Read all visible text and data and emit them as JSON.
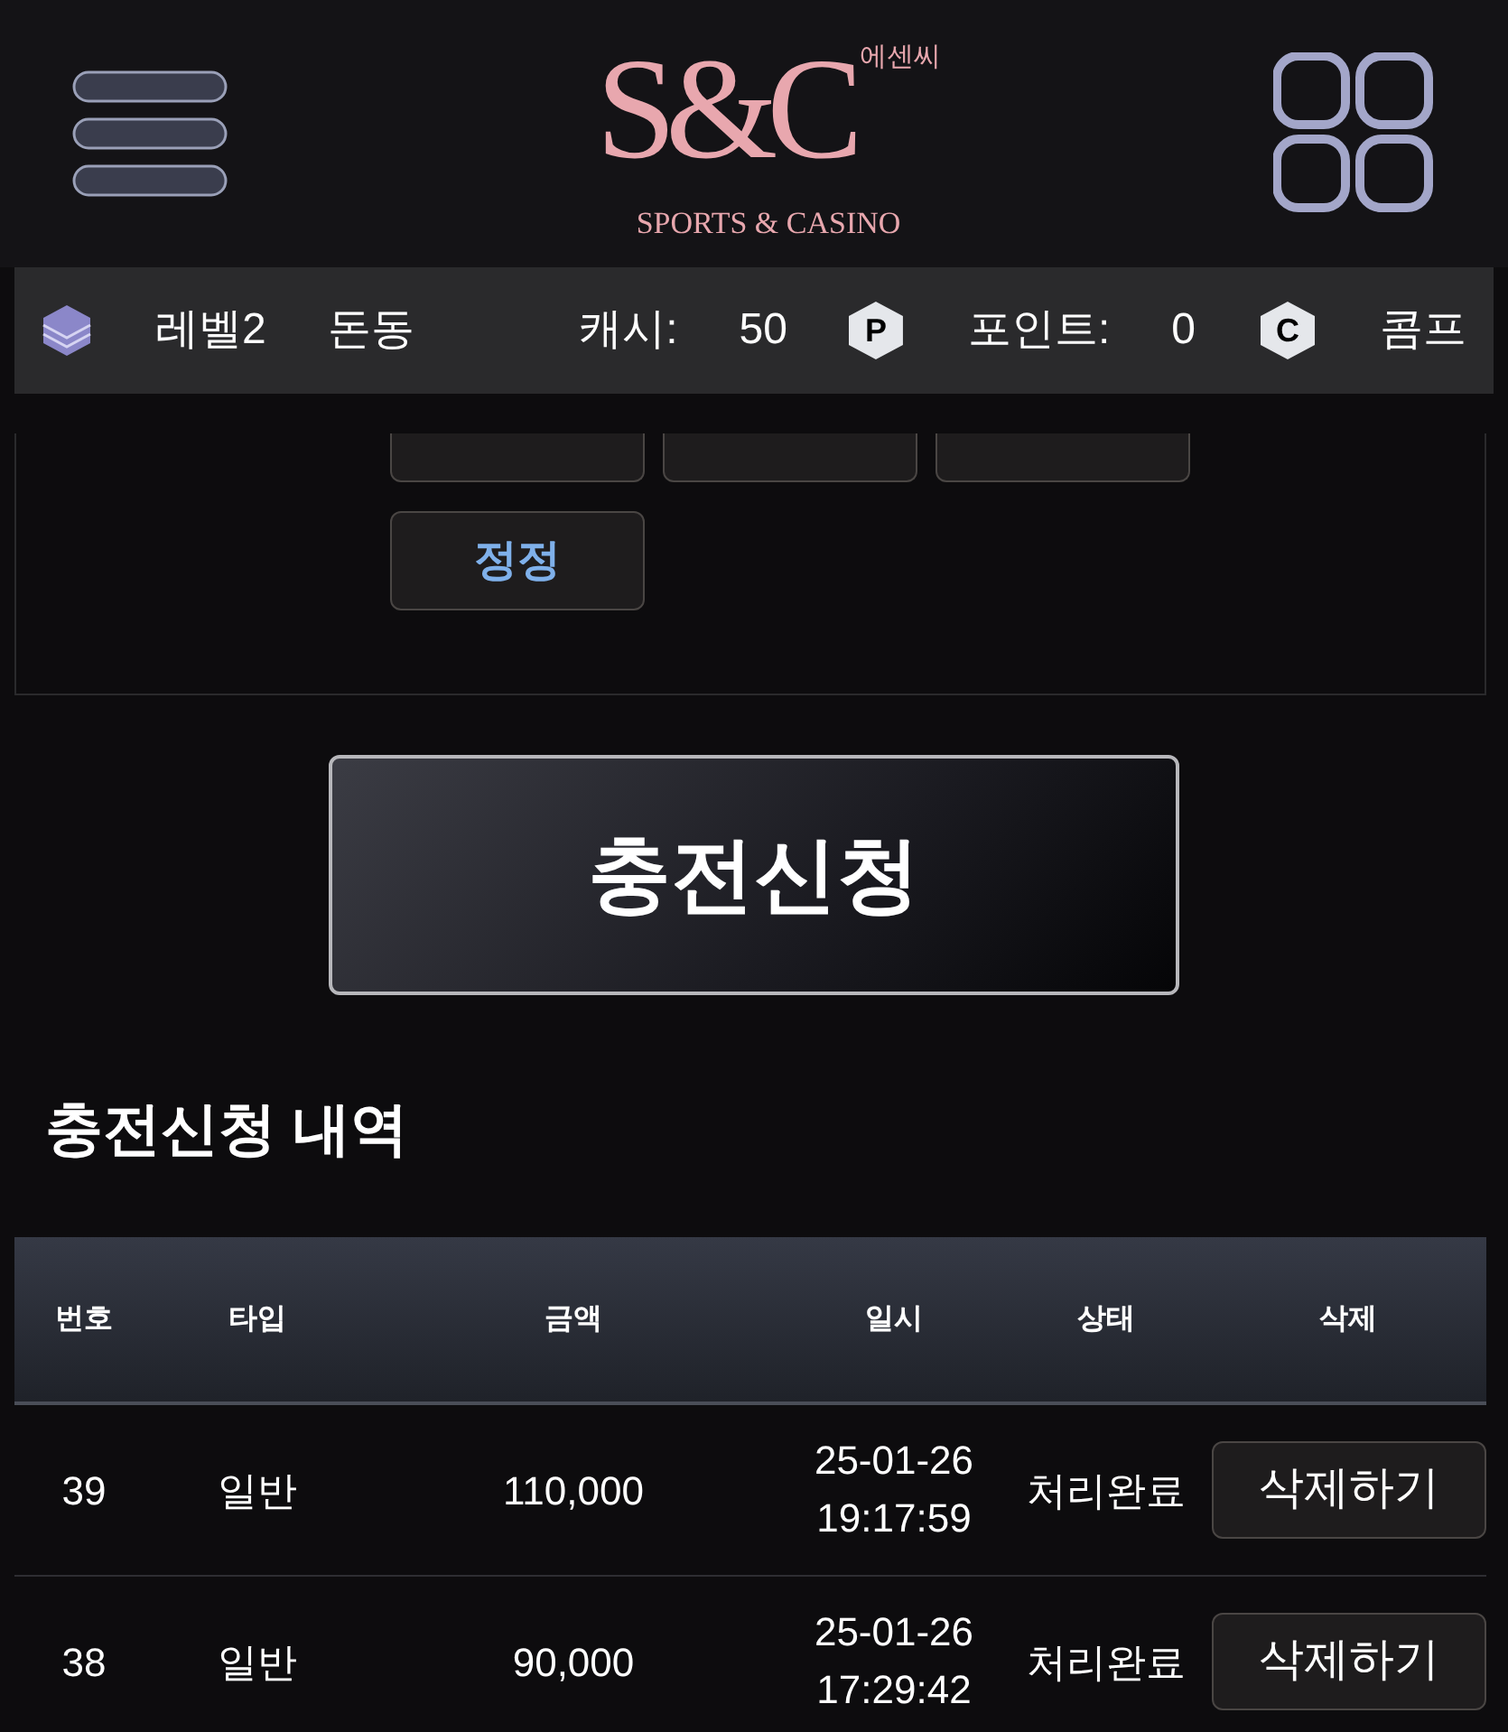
{
  "logo": {
    "monogram": "S&C",
    "korean": "에센씨",
    "tagline": "SPORTS & CASINO"
  },
  "status_bar": {
    "level": "레벨2",
    "nickname": "돈동",
    "cash_label": "캐시:",
    "cash": "50",
    "point_badge": "P",
    "point_label": "포인트:",
    "point": "0",
    "comp_badge": "C",
    "comp_label": "콤프"
  },
  "amount_buttons": [
    {
      "kind": "covered"
    },
    {
      "kind": "covered"
    },
    {
      "kind": "covered"
    },
    {
      "kind": "reset",
      "label": "정정"
    }
  ],
  "submit_button": "충전신청",
  "history": {
    "title": "충전신청 내역",
    "columns": [
      "번호",
      "타입",
      "금액",
      "일시",
      "상태",
      "삭제"
    ],
    "rows": [
      {
        "no": "39",
        "type": "일반",
        "amount": "110,000",
        "date": "25-01-26",
        "time": "19:17:59",
        "status": "처리완료",
        "action": "삭제하기"
      },
      {
        "no": "38",
        "type": "일반",
        "amount": "90,000",
        "date": "25-01-26",
        "time": "17:29:42",
        "status": "처리완료",
        "action": "삭제하기"
      }
    ]
  }
}
